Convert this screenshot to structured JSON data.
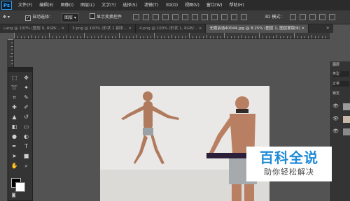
{
  "app": {
    "logo": "Ps"
  },
  "menu": [
    "文件(F)",
    "编辑(E)",
    "图像(I)",
    "图层(L)",
    "文字(Y)",
    "选择(S)",
    "滤镜(T)",
    "3D(D)",
    "视图(V)",
    "窗口(W)",
    "帮助(H)"
  ],
  "options": {
    "auto_select_label": "自动选择：",
    "auto_select_value": "图层",
    "transform_label": "显示变换控件",
    "mode3d_label": "3D 模式："
  },
  "tabs": [
    {
      "label": "Lang @ 100% (图层 0, RGB/..."
    },
    {
      "label": "3.png @ 100% (形状 1 副本..."
    },
    {
      "label": "4.png @ 100% (形状 1, RGB/..."
    },
    {
      "label": "无题会话40044.jpg @ 8.25% (图层 1, 图层蒙版/8)"
    }
  ],
  "tab_overflow": "»",
  "right_panel": {
    "tab": "图层",
    "kind": "类型",
    "blend": "正常",
    "lock": "锁定"
  },
  "watermark": {
    "title": "百科全说",
    "subtitle": "助你轻松解决"
  },
  "colors": {
    "fg": "#000000",
    "bg": "#ffffff"
  }
}
